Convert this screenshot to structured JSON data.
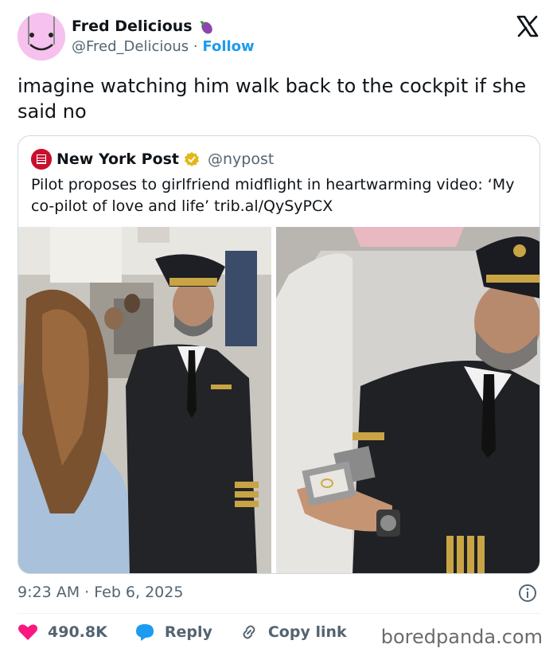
{
  "author": {
    "name": "Fred Delicious",
    "name_emoji": "eggplant-icon",
    "handle": "@Fred_Delicious",
    "separator": "·",
    "follow_label": "Follow"
  },
  "tweet_text": "imagine watching him walk back to the cockpit if she said no",
  "quote": {
    "name": "New York Post",
    "handle": "@nypost",
    "text": "Pilot proposes to girlfriend midflight in heartwarming video: ‘My co-pilot of love and life’ trib.al/QySyPCX"
  },
  "footer": {
    "time": "9:23 AM",
    "separator": "·",
    "date": "Feb 6, 2025",
    "likes": "490.8K",
    "reply_label": "Reply",
    "copy_link_label": "Copy link"
  },
  "watermark": "boredpanda.com",
  "colors": {
    "accent": "#1d9bf0",
    "like": "#f91880",
    "nyp_red": "#c8102e",
    "verified_gold": "#e2b719"
  }
}
